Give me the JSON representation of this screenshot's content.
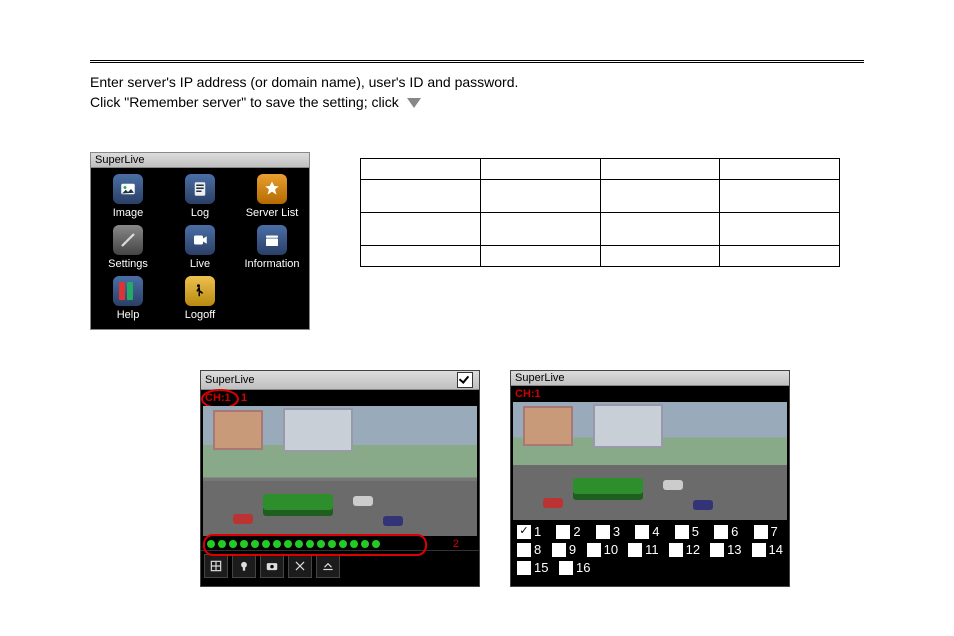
{
  "instructions": {
    "line1": "Enter server's IP address (or domain name), user's ID and password.",
    "line2a": "Click \"Remember server\" to save the setting; click"
  },
  "menu": {
    "title": "SuperLive",
    "items": [
      {
        "label": "Image"
      },
      {
        "label": "Log"
      },
      {
        "label": "Server List"
      },
      {
        "label": "Settings"
      },
      {
        "label": "Live"
      },
      {
        "label": "Information"
      },
      {
        "label": "Help"
      },
      {
        "label": "Logoff"
      }
    ]
  },
  "live_left": {
    "title": "SuperLive",
    "channel": "CH:1",
    "marker1": "1",
    "marker2": "2"
  },
  "live_right": {
    "title": "SuperLive",
    "channel": "CH:1",
    "channels": [
      1,
      2,
      3,
      4,
      5,
      6,
      7,
      8,
      9,
      10,
      11,
      12,
      13,
      14,
      15,
      16
    ],
    "checked": 1
  },
  "table": {
    "rows": 4,
    "cols": 4
  }
}
